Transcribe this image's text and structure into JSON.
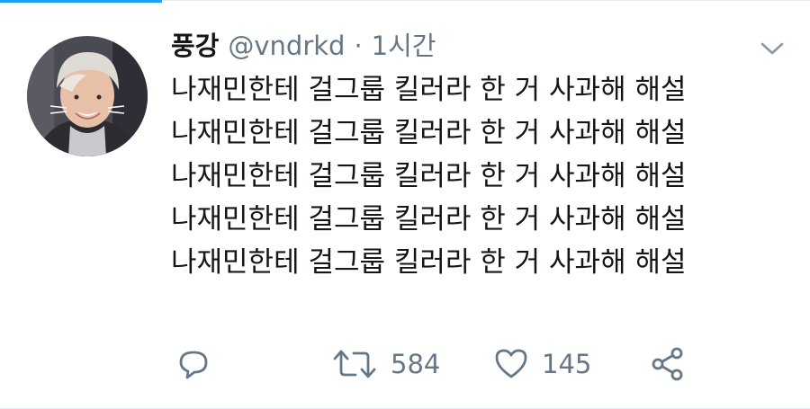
{
  "tweet": {
    "display_name": "풍강",
    "handle": "@vndrkd",
    "separator": "·",
    "time": "1시간",
    "lines": [
      "나재민한테 걸그룹 킬러라 한 거 사과해 해설",
      "나재민한테 걸그룹 킬러라 한 거 사과해 해설",
      "나재민한테 걸그룹 킬러라 한 거 사과해 해설",
      "나재민한테 걸그룹 킬러라 한 거 사과해 해설",
      "나재민한테 걸그룹 킬러라 한 거 사과해 해설"
    ]
  },
  "actions": {
    "retweet_count": "584",
    "like_count": "145"
  },
  "icons": {
    "more": "chevron-down-icon",
    "reply": "reply-icon",
    "retweet": "retweet-icon",
    "like": "heart-icon",
    "share": "share-icon"
  },
  "colors": {
    "accent": "#1da1f2",
    "text": "#14171a",
    "muted": "#657786"
  }
}
